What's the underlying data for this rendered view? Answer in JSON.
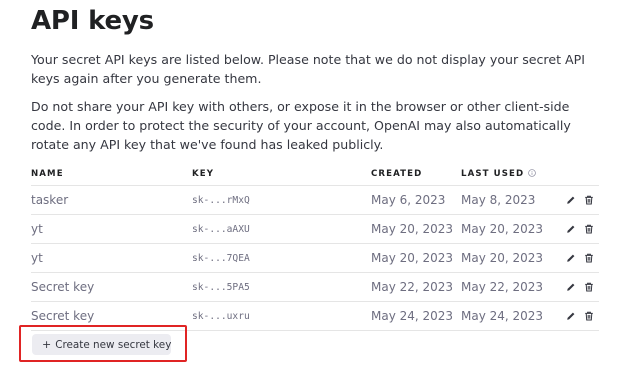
{
  "page": {
    "title": "API keys",
    "description_1": "Your secret API keys are listed below. Please note that we do not display your secret API keys again after you generate them.",
    "description_2": "Do not share your API key with others, or expose it in the browser or other client-side code. In order to protect the security of your account, OpenAI may also automatically rotate any API key that we've found has leaked publicly."
  },
  "table": {
    "headers": {
      "name": "NAME",
      "key": "KEY",
      "created": "CREATED",
      "last_used": "LAST USED"
    },
    "rows": [
      {
        "name": "tasker",
        "key": "sk-...rMxQ",
        "created": "May 6, 2023",
        "last_used": "May 8, 2023"
      },
      {
        "name": "yt",
        "key": "sk-...aAXU",
        "created": "May 20, 2023",
        "last_used": "May 20, 2023"
      },
      {
        "name": "yt",
        "key": "sk-...7QEA",
        "created": "May 20, 2023",
        "last_used": "May 20, 2023"
      },
      {
        "name": "Secret key",
        "key": "sk-...5PA5",
        "created": "May 22, 2023",
        "last_used": "May 22, 2023"
      },
      {
        "name": "Secret key",
        "key": "sk-...uxru",
        "created": "May 24, 2023",
        "last_used": "May 24, 2023"
      }
    ]
  },
  "actions": {
    "create_label": "Create new secret key",
    "create_icon": "plus-icon",
    "edit_icon": "pencil-icon",
    "delete_icon": "trash-icon"
  },
  "colors": {
    "highlight_border": "#e02424",
    "button_bg": "#ececf1"
  }
}
